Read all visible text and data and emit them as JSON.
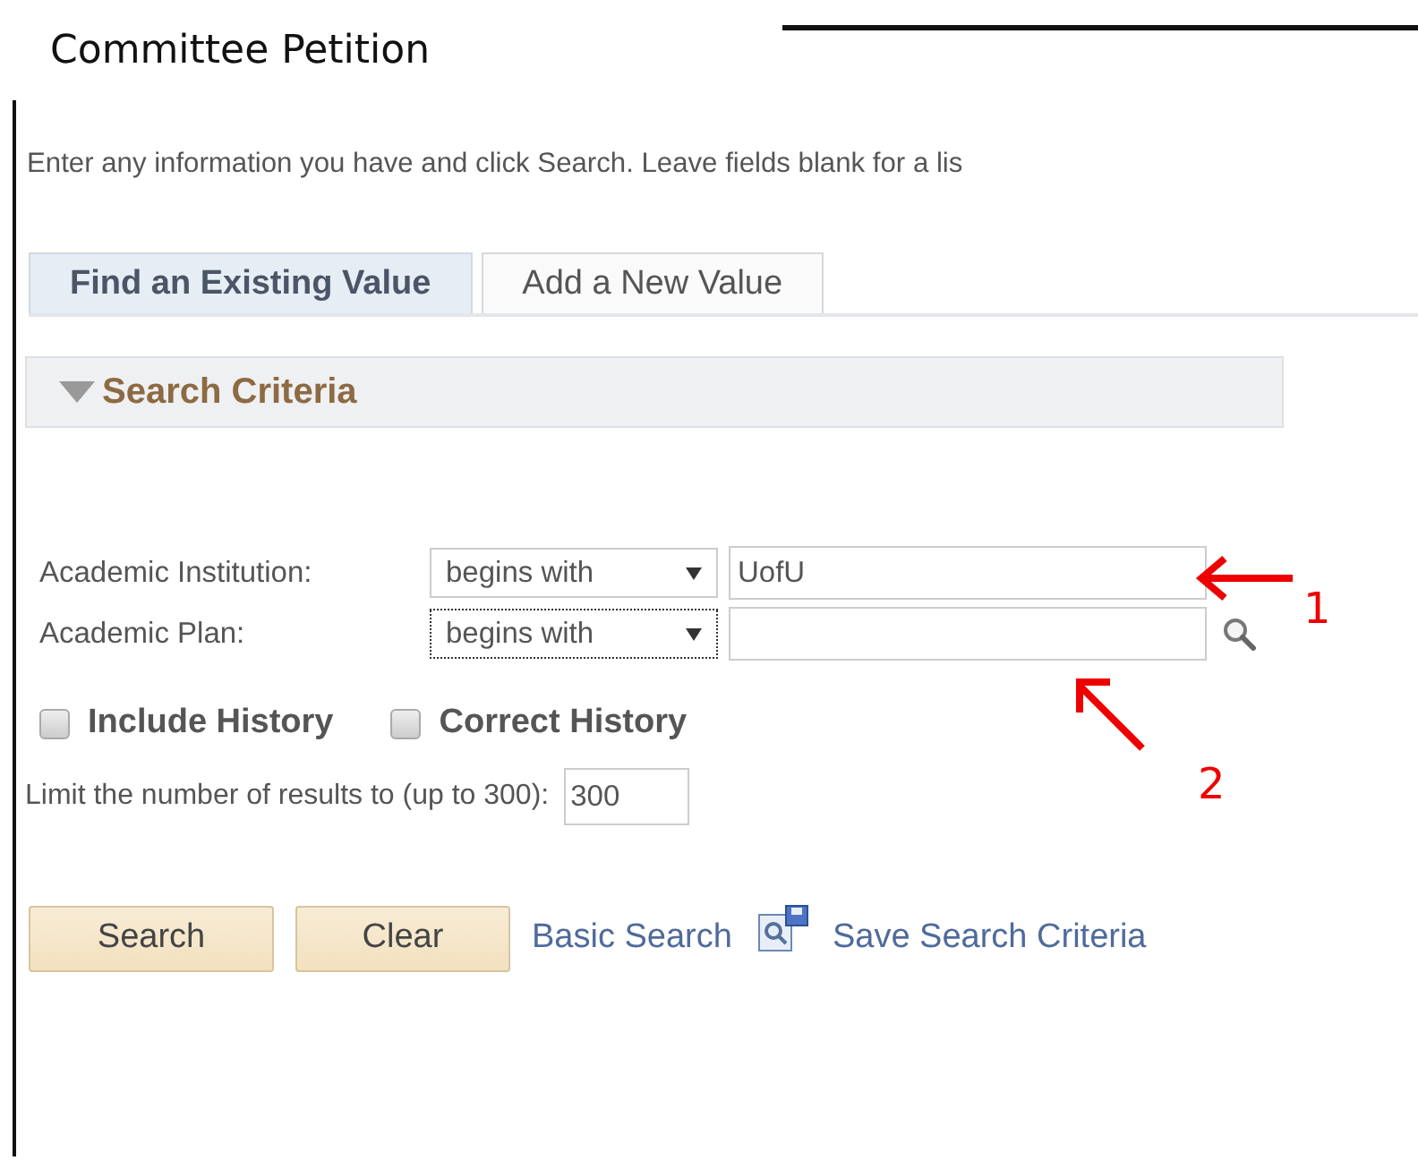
{
  "title": "Committee Petition",
  "instructions": "Enter any information you have and click Search. Leave fields blank for a lis",
  "tabs": [
    {
      "label": "Find an Existing Value",
      "selected": true
    },
    {
      "label": "Add a New Value",
      "selected": false
    }
  ],
  "section": {
    "title": "Search Criteria",
    "expanded": true
  },
  "criteria": [
    {
      "label": "Academic Institution:",
      "operator": "begins with",
      "value": "UofU",
      "lookup": false,
      "focused": false
    },
    {
      "label": "Academic Plan:",
      "operator": "begins with",
      "lookup": true,
      "focused": true
    }
  ],
  "checkboxes": [
    {
      "label": "Include History",
      "checked": false
    },
    {
      "label": "Correct History",
      "checked": false
    }
  ],
  "limit": {
    "label": "Limit the number of results to (up to 300):",
    "value": "300"
  },
  "buttons": [
    "Search",
    "Clear"
  ],
  "links": [
    {
      "label": "Basic Search",
      "icon": false
    },
    {
      "label": "Save Search Criteria",
      "icon": true
    }
  ],
  "annotations": [
    {
      "label": "1"
    },
    {
      "label": "2"
    }
  ]
}
